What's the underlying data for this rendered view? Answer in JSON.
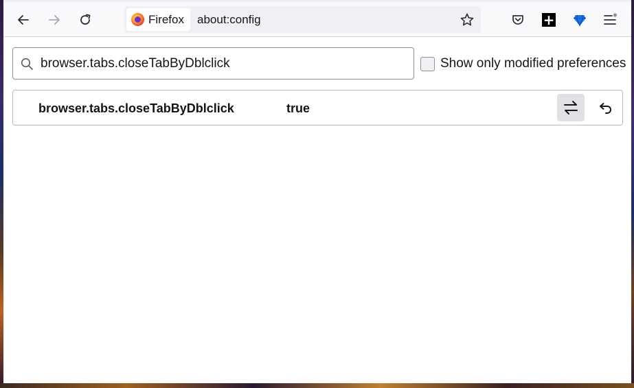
{
  "browser": {
    "identity_label": "Firefox",
    "url": "about:config",
    "icons": {
      "back": "back-arrow-icon",
      "forward": "forward-arrow-icon",
      "reload": "reload-icon",
      "bookmark": "star-icon",
      "pocket": "pocket-icon",
      "extension_plus": "plus-square-icon",
      "extension_gem": "gem-icon",
      "menu": "hamburger-menu-icon"
    }
  },
  "config": {
    "search_value": "browser.tabs.closeTabByDblclick",
    "show_modified_label": "Show only modified preferences",
    "show_modified_checked": false,
    "preference": {
      "name": "browser.tabs.closeTabByDblclick",
      "value": "true",
      "toggle_icon": "toggle-arrows-icon",
      "reset_icon": "reset-undo-icon"
    }
  },
  "colors": {
    "accent_gem": "#1a73e8",
    "toolbar_bg": "#f9f9fb",
    "urlbar_bg": "#f0f0f4"
  }
}
